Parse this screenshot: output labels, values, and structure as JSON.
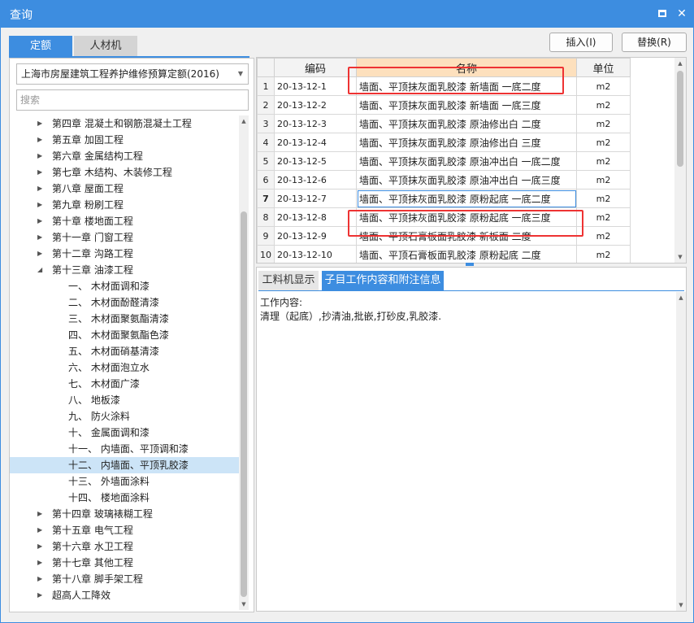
{
  "window": {
    "title": "查询"
  },
  "tabs": {
    "quota": "定额",
    "materials": "人材机"
  },
  "buttons": {
    "insert": "插入(I)",
    "replace": "替换(R)"
  },
  "library_select": {
    "value": "上海市房屋建筑工程养护维修预算定额(2016)"
  },
  "search": {
    "placeholder": "搜索"
  },
  "tree": [
    {
      "label": "第四章 混凝土和钢筋混凝土工程",
      "level": 1,
      "expanded": false
    },
    {
      "label": "第五章 加固工程",
      "level": 1,
      "expanded": false
    },
    {
      "label": "第六章 金属结构工程",
      "level": 1,
      "expanded": false
    },
    {
      "label": "第七章 木结构、木装修工程",
      "level": 1,
      "expanded": false
    },
    {
      "label": "第八章 屋面工程",
      "level": 1,
      "expanded": false
    },
    {
      "label": "第九章 粉刷工程",
      "level": 1,
      "expanded": false
    },
    {
      "label": "第十章 楼地面工程",
      "level": 1,
      "expanded": false
    },
    {
      "label": "第十一章 门窗工程",
      "level": 1,
      "expanded": false
    },
    {
      "label": "第十二章 沟路工程",
      "level": 1,
      "expanded": false
    },
    {
      "label": "第十三章 油漆工程",
      "level": 1,
      "expanded": true
    },
    {
      "label": "一、  木材面调和漆",
      "level": 2
    },
    {
      "label": "二、  木材面酚醛清漆",
      "level": 2
    },
    {
      "label": "三、  木材面聚氨酯清漆",
      "level": 2
    },
    {
      "label": "四、  木材面聚氨酯色漆",
      "level": 2
    },
    {
      "label": "五、  木材面硝基清漆",
      "level": 2
    },
    {
      "label": "六、  木材面泡立水",
      "level": 2
    },
    {
      "label": "七、  木材面广漆",
      "level": 2
    },
    {
      "label": "八、  地板漆",
      "level": 2
    },
    {
      "label": "九、  防火涂料",
      "level": 2
    },
    {
      "label": "十、  金属面调和漆",
      "level": 2
    },
    {
      "label": "十一、  内墙面、平顶调和漆",
      "level": 2
    },
    {
      "label": "十二、  内墙面、平顶乳胶漆",
      "level": 2,
      "selected": true
    },
    {
      "label": "十三、  外墙面涂料",
      "level": 2
    },
    {
      "label": "十四、  楼地面涂料",
      "level": 2
    },
    {
      "label": "第十四章 玻璃裱糊工程",
      "level": 1,
      "expanded": false
    },
    {
      "label": "第十五章 电气工程",
      "level": 1,
      "expanded": false
    },
    {
      "label": "第十六章 水卫工程",
      "level": 1,
      "expanded": false
    },
    {
      "label": "第十七章 其他工程",
      "level": 1,
      "expanded": false
    },
    {
      "label": "第十八章 脚手架工程",
      "level": 1,
      "expanded": false
    },
    {
      "label": "超高人工降效",
      "level": 1,
      "expanded": false
    }
  ],
  "grid": {
    "headers": {
      "code": "编码",
      "name": "名称",
      "unit": "单位"
    },
    "rows": [
      {
        "num": "1",
        "code": "20-13-12-1",
        "name": "墙面、平顶抹灰面乳胶漆 新墙面 一底二度",
        "unit": "m2"
      },
      {
        "num": "2",
        "code": "20-13-12-2",
        "name": "墙面、平顶抹灰面乳胶漆 新墙面 一底三度",
        "unit": "m2"
      },
      {
        "num": "3",
        "code": "20-13-12-3",
        "name": "墙面、平顶抹灰面乳胶漆 原油修出白 二度",
        "unit": "m2"
      },
      {
        "num": "4",
        "code": "20-13-12-4",
        "name": "墙面、平顶抹灰面乳胶漆 原油修出白 三度",
        "unit": "m2"
      },
      {
        "num": "5",
        "code": "20-13-12-5",
        "name": "墙面、平顶抹灰面乳胶漆 原油冲出白 一底二度",
        "unit": "m2"
      },
      {
        "num": "6",
        "code": "20-13-12-6",
        "name": "墙面、平顶抹灰面乳胶漆 原油冲出白 一底三度",
        "unit": "m2"
      },
      {
        "num": "7",
        "code": "20-13-12-7",
        "name": "墙面、平顶抹灰面乳胶漆 原粉起底 一底二度",
        "unit": "m2",
        "current": true
      },
      {
        "num": "8",
        "code": "20-13-12-8",
        "name": "墙面、平顶抹灰面乳胶漆 原粉起底 一底三度",
        "unit": "m2"
      },
      {
        "num": "9",
        "code": "20-13-12-9",
        "name": "墙面、平顶石膏板面乳胶漆 新板面 二度",
        "unit": "m2"
      },
      {
        "num": "10",
        "code": "20-13-12-10",
        "name": "墙面、平顶石膏板面乳胶漆 原粉起底 二度",
        "unit": "m2"
      }
    ]
  },
  "bottom_tabs": {
    "labor": "工料机显示",
    "work": "子目工作内容和附注信息"
  },
  "work_content": {
    "label": "工作内容:",
    "text": "清理（起底）,抄清油,批嵌,打砂皮,乳胶漆."
  },
  "colors": {
    "accent": "#3d8de0",
    "name_header": "#fde0bd",
    "selected_tree": "#cce4f7",
    "highlight": "#ee3333"
  }
}
